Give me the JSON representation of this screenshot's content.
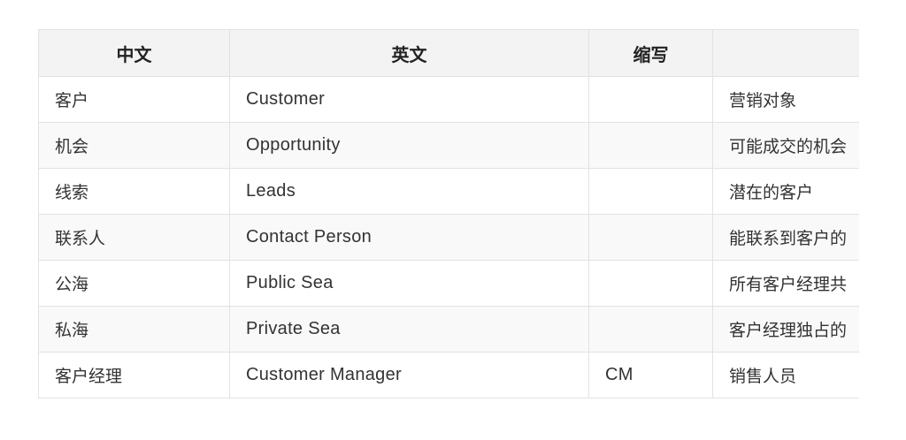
{
  "table": {
    "headers": [
      "中文",
      "英文",
      "缩写",
      ""
    ],
    "rows": [
      [
        "客户",
        "Customer",
        "",
        "营销对象"
      ],
      [
        "机会",
        "Opportunity",
        "",
        "可能成交的机会"
      ],
      [
        "线索",
        "Leads",
        "",
        "潜在的客户"
      ],
      [
        "联系人",
        "Contact Person",
        "",
        "能联系到客户的"
      ],
      [
        "公海",
        "Public Sea",
        "",
        "所有客户经理共"
      ],
      [
        "私海",
        "Private Sea",
        "",
        "客户经理独占的"
      ],
      [
        "客户经理",
        "Customer Manager",
        "CM",
        "销售人员"
      ]
    ]
  }
}
